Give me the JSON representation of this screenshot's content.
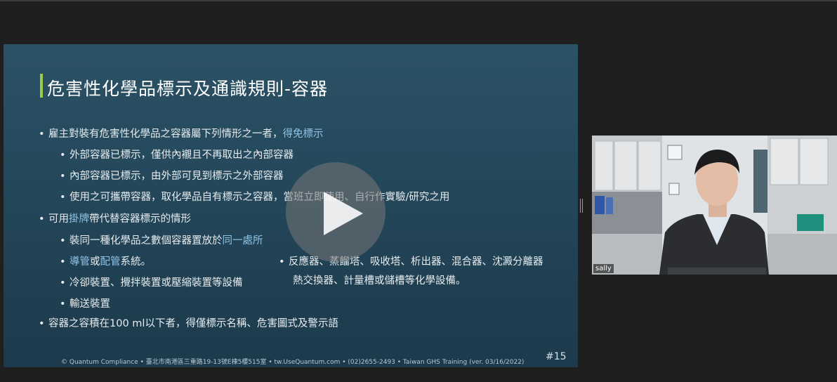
{
  "slide": {
    "title": "危害性化學品標示及通識規則-容器",
    "bullets": {
      "b1": {
        "text": "雇主對裝有危害性化學品之容器屬下列情形之一者，",
        "hl": "得免標示"
      },
      "s1": "外部容器已標示，僅供內襯且不再取出之內部容器",
      "s2": "內部容器已標示，由外部可見到標示之外部容器",
      "s3": "使用之可攜帶容器，取化學品自有標示之容器，當班立即使用、自行作實驗/研究之用",
      "b2": {
        "pre": "可用",
        "hl": "掛牌",
        "post": "帶代替容器標示的情形"
      },
      "s4": {
        "pre": "裝同一種化學品之數個容器置放於",
        "hl": "同一處所"
      },
      "s5": {
        "hl1": "導管",
        "mid": "或",
        "hl2": "配管",
        "post": "系統。"
      },
      "s6": "冷卻裝置、攪拌裝置或壓縮裝置等設備",
      "s7": "輸送裝置",
      "r1": "反應器、蒸餾塔、吸收塔、析出器、混合器、沈澱分離器",
      "r2": "熱交換器、計量槽或儲槽等化學設備。",
      "b3": "容器之容積在100 ml以下者，得僅標示名稱、危害圖式及警示語"
    },
    "footer": "© Quantum Compliance • 臺北市南港區三重路19-13號E棟5樓515室 • tw.UseQuantum.com • (02)2655-2493 • Taiwan GHS Training (ver. 03/16/2022)",
    "page_number": "#15"
  },
  "webcam": {
    "participant_name": "sally"
  },
  "icons": {
    "play": "play-icon",
    "bullet": "bullet-icon",
    "handle": "drag-handle-icon"
  },
  "colors": {
    "accent_bar": "#9ccc45",
    "highlight": "#8fc3e6"
  }
}
